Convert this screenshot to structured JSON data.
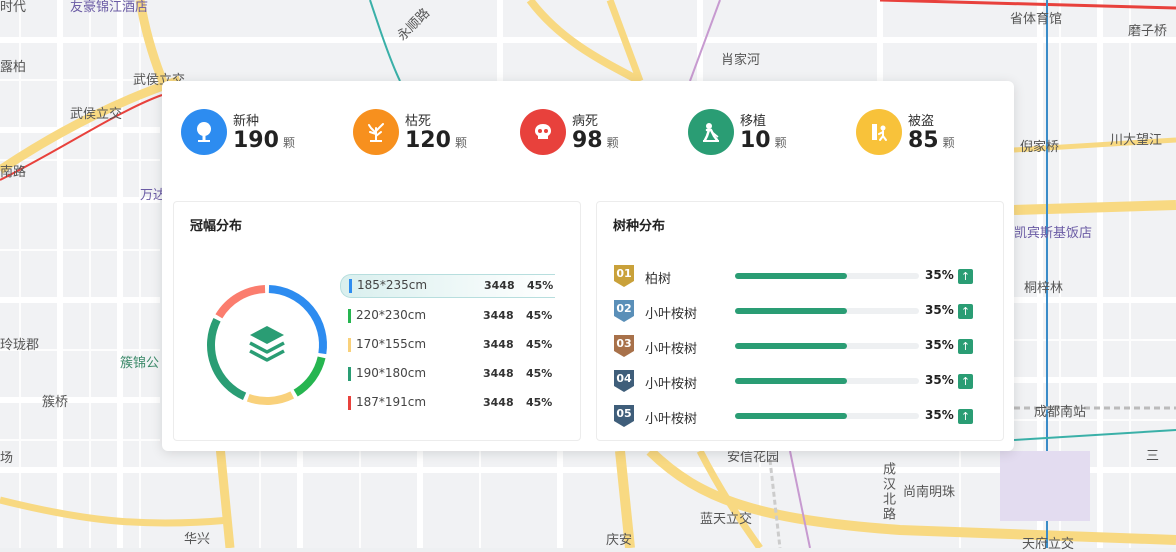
{
  "map": {
    "labels": [
      {
        "text": "时代",
        "cls": ""
      },
      {
        "text": "友豪锦江酒店",
        "cls": "purple"
      },
      {
        "text": "永顺路",
        "cls": ""
      },
      {
        "text": "肖家河",
        "cls": ""
      },
      {
        "text": "省体育馆",
        "cls": ""
      },
      {
        "text": "磨子桥",
        "cls": ""
      },
      {
        "text": "露柏",
        "cls": ""
      },
      {
        "text": "武侯立交",
        "cls": ""
      },
      {
        "text": "武侯立交",
        "cls": ""
      },
      {
        "text": "南路",
        "cls": ""
      },
      {
        "text": "万达",
        "cls": "purple"
      },
      {
        "text": "倪家桥",
        "cls": ""
      },
      {
        "text": "川大望江",
        "cls": ""
      },
      {
        "text": "凯宾斯基饭店",
        "cls": "purple"
      },
      {
        "text": "桐梓林",
        "cls": ""
      },
      {
        "text": "玲珑郡",
        "cls": ""
      },
      {
        "text": "簇锦公",
        "cls": "teal"
      },
      {
        "text": "簇桥",
        "cls": ""
      },
      {
        "text": "场",
        "cls": ""
      },
      {
        "text": "成都南站",
        "cls": ""
      },
      {
        "text": "安信花园",
        "cls": ""
      },
      {
        "text": "成汉北路",
        "cls": "vert"
      },
      {
        "text": "尚南明珠",
        "cls": ""
      },
      {
        "text": "蓝天立交",
        "cls": ""
      },
      {
        "text": "华兴",
        "cls": ""
      },
      {
        "text": "庆安",
        "cls": ""
      },
      {
        "text": "天府立交",
        "cls": ""
      },
      {
        "text": "三",
        "cls": ""
      }
    ]
  },
  "stats": [
    {
      "label": "新种",
      "value": "190",
      "unit": "颗",
      "color": "#2d8cf0",
      "icon": "tree-icon"
    },
    {
      "label": "枯死",
      "value": "120",
      "unit": "颗",
      "color": "#f7901e",
      "icon": "dead-tree-icon"
    },
    {
      "label": "病死",
      "value": "98",
      "unit": "颗",
      "color": "#e8413c",
      "icon": "skull-icon"
    },
    {
      "label": "移植",
      "value": "10",
      "unit": "颗",
      "color": "#2a9d74",
      "icon": "worker-shovel-icon"
    },
    {
      "label": "被盗",
      "value": "85",
      "unit": "颗",
      "color": "#f8c23a",
      "icon": "stolen-tree-icon"
    }
  ],
  "crown": {
    "title": "冠幅分布",
    "center_icon": "layers-icon",
    "chart_data": {
      "type": "pie",
      "segments": [
        {
          "color": "#2d8cf0",
          "value": 28
        },
        {
          "color": "#26b550",
          "value": 14
        },
        {
          "color": "#f9d17b",
          "value": 14
        },
        {
          "color": "#2a9d74",
          "value": 27
        },
        {
          "color": "#fb7d6e",
          "value": 17
        }
      ]
    },
    "rows": [
      {
        "size": "185*235cm",
        "count": "3448",
        "pct": "45%",
        "color": "#2d8cf0",
        "active": true
      },
      {
        "size": "220*230cm",
        "count": "3448",
        "pct": "45%",
        "color": "#26b550",
        "active": false
      },
      {
        "size": "170*155cm",
        "count": "3448",
        "pct": "45%",
        "color": "#f9d17b",
        "active": false
      },
      {
        "size": "190*180cm",
        "count": "3448",
        "pct": "45%",
        "color": "#2a9d74",
        "active": false
      },
      {
        "size": "187*191cm",
        "count": "3448",
        "pct": "45%",
        "color": "#e8413c",
        "active": false
      }
    ]
  },
  "species": {
    "title": "树种分布",
    "rows": [
      {
        "rank": "01",
        "name": "柏树",
        "pct": "35%",
        "fill": 0.61,
        "badge": "#c9a13a"
      },
      {
        "rank": "02",
        "name": "小叶桉树",
        "pct": "35%",
        "fill": 0.61,
        "badge": "#5a8fb8"
      },
      {
        "rank": "03",
        "name": "小叶桉树",
        "pct": "35%",
        "fill": 0.61,
        "badge": "#a8714a"
      },
      {
        "rank": "04",
        "name": "小叶桉树",
        "pct": "35%",
        "fill": 0.61,
        "badge": "#3f5e7a"
      },
      {
        "rank": "05",
        "name": "小叶桉树",
        "pct": "35%",
        "fill": 0.61,
        "badge": "#3f5e7a"
      }
    ]
  }
}
